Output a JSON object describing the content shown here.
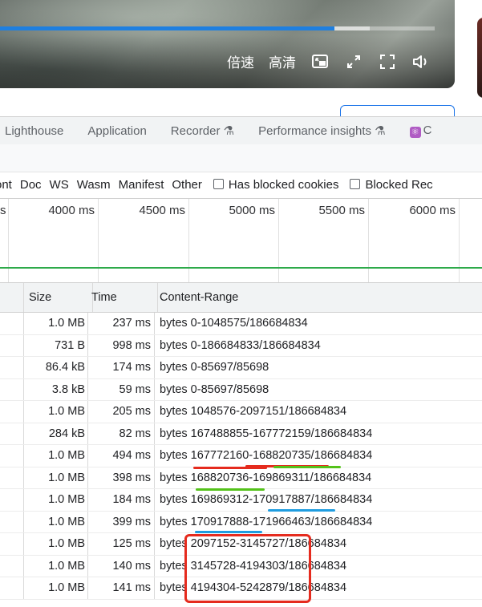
{
  "player": {
    "progress_percent": 77,
    "buffer_percent": 85,
    "speed_label": "倍速",
    "quality_label": "高清",
    "controls": [
      "picture-in-picture-icon",
      "web-fullscreen-icon",
      "fullscreen-icon",
      "volume-icon"
    ]
  },
  "tabs": [
    {
      "label": "Lighthouse"
    },
    {
      "label": "Application"
    },
    {
      "label": "Recorder",
      "icon": "flask-icon"
    },
    {
      "label": "Performance insights",
      "icon": "flask-icon"
    },
    {
      "label": "C",
      "icon": "react-icon"
    }
  ],
  "filters": {
    "types": [
      "ont",
      "Doc",
      "WS",
      "Wasm",
      "Manifest",
      "Other"
    ],
    "checkboxes": [
      "Has blocked cookies",
      "Blocked Rec"
    ]
  },
  "timeline": {
    "ticks": [
      "s",
      "4000 ms",
      "4500 ms",
      "5000 ms",
      "5500 ms",
      "6000 ms"
    ]
  },
  "table": {
    "headers": {
      "size": "Size",
      "time": "Time",
      "range": "Content-Range"
    },
    "rows": [
      {
        "size": "1.0 MB",
        "time": "237 ms",
        "range": "bytes 0-1048575/186684834"
      },
      {
        "size": "731 B",
        "time": "998 ms",
        "range": "bytes 0-186684833/186684834"
      },
      {
        "size": "86.4 kB",
        "time": "174 ms",
        "range": "bytes 0-85697/85698"
      },
      {
        "size": "3.8 kB",
        "time": "59 ms",
        "range": "bytes 0-85697/85698"
      },
      {
        "size": "1.0 MB",
        "time": "205 ms",
        "range": "bytes 1048576-2097151/186684834"
      },
      {
        "size": "284 kB",
        "time": "82 ms",
        "range": "bytes 167488855-167772159/186684834"
      },
      {
        "size": "1.0 MB",
        "time": "494 ms",
        "range": "bytes 167772160-168820735/186684834"
      },
      {
        "size": "1.0 MB",
        "time": "398 ms",
        "range": "bytes 168820736-169869311/186684834"
      },
      {
        "size": "1.0 MB",
        "time": "184 ms",
        "range": "bytes 169869312-170917887/186684834"
      },
      {
        "size": "1.0 MB",
        "time": "399 ms",
        "range": "bytes 170917888-171966463/186684834"
      },
      {
        "size": "1.0 MB",
        "time": "125 ms",
        "range": "bytes 2097152-3145727/186684834"
      },
      {
        "size": "1.0 MB",
        "time": "140 ms",
        "range": "bytes 3145728-4194303/186684834"
      },
      {
        "size": "1.0 MB",
        "time": "141 ms",
        "range": "bytes 4194304-5242879/186684834"
      }
    ]
  },
  "annotation_colors": {
    "red": "#e52b1e",
    "green": "#54c21a",
    "blue": "#1f9de0"
  }
}
